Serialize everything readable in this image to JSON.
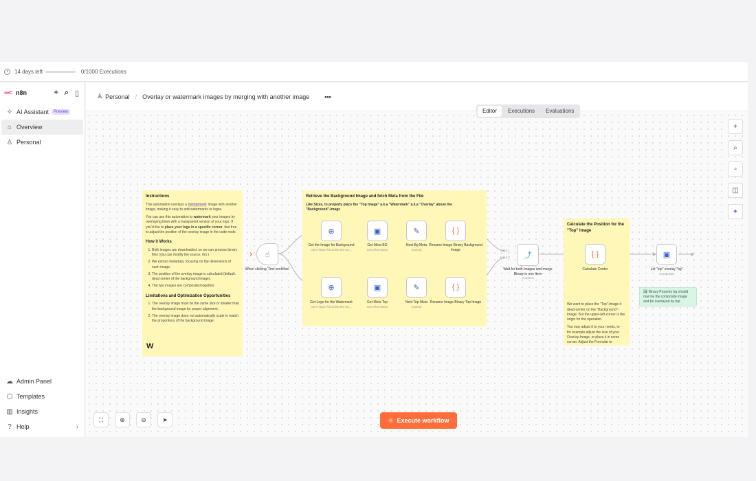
{
  "trial": {
    "days_left": "14 days left",
    "executions": "0/1000 Executions"
  },
  "sidebar": {
    "brand": "n8n",
    "items": [
      {
        "label": "AI Assistant",
        "badge": "Preview"
      },
      {
        "label": "Overview"
      },
      {
        "label": "Personal"
      }
    ],
    "bottom": [
      {
        "label": "Admin Panel"
      },
      {
        "label": "Templates"
      },
      {
        "label": "Insights"
      },
      {
        "label": "Help"
      }
    ]
  },
  "header": {
    "project": "Personal",
    "workflow_title": "Overlay or watermark images by merging with another image",
    "more": "•••"
  },
  "tabs": [
    "Editor",
    "Executions",
    "Evaluations"
  ],
  "stickies": {
    "instructions": {
      "title": "Instructions",
      "p1_a": "This automation overlays a ",
      "p1_code": "background",
      "p1_b": " image with another image, making it easy to add watermarks or logos.",
      "p2_a": "You can use this automation to ",
      "p2_bold": "watermark",
      "p2_b": " your images by overlaying them with a transparent version of your logo. If you'd like to ",
      "p2_bold2": "place your logo in a specific corner",
      "p2_c": ", feel free to adjust the position of the overlay image in the code node.",
      "how_title": "How it Works",
      "how": [
        "Both images are downloaded, so we can process binary files (you can modify the source, tho.)",
        "We extract metadata, focusing on the dimensions of each image.",
        "The position of the overlay image is calculated (default: dead center of the background image).",
        "The two images are composited together."
      ],
      "lim_title": "Limitations and Optimization Opportunities",
      "lim": [
        "The overlay image must be the same size or smaller than the background image for proper alignment.",
        "The overlay image does not automatically scale to match the proportions of the background image."
      ],
      "logo": "W"
    },
    "retrieve": {
      "title": "Retrieve the Background Image and fetch Meta from the File",
      "body": "Like Sizes, to properly place the \"Top Image\" a.k.a \"Watermark\" a.k.a \"Overlay\" above the \"Background\"-Image"
    },
    "calculate": {
      "title": "Calculate the Position for the \"Top\" Image",
      "p1": "We want to place the \"Top\"-Image it dead-center on the \"Background\"-Image. But the upper-left-corner is the origin for the operation.",
      "p2": "You may adjust it to your needs, to - for example adjust the size of your Overlay-Image, or place it in some corner. Adjust the Formular to"
    }
  },
  "nodes": [
    {
      "id": "trigger",
      "label": "When clicking ‘Test workflow’",
      "sub": "",
      "icon": "cursor-icon"
    },
    {
      "id": "get_bg",
      "label": "Get the Image for Background",
      "sub": "GET: https://cloudinit.the wo...",
      "icon": "globe-icon"
    },
    {
      "id": "meta_bg",
      "label": "Get Meta BG",
      "sub": "Get Information",
      "icon": "image-icon"
    },
    {
      "id": "next_bg",
      "label": "Next Bg Meta",
      "sub": "manual",
      "icon": "edit-icon"
    },
    {
      "id": "rename_bg",
      "label": "Rename Image Binary Background Image",
      "sub": "",
      "icon": "braces-icon"
    },
    {
      "id": "get_logo",
      "label": "Get Logo for the Watermark",
      "sub": "GET: https://cloudinit.the wo...",
      "icon": "globe-icon"
    },
    {
      "id": "meta_top",
      "label": "Get Meta Top",
      "sub": "Get Information",
      "icon": "image-icon"
    },
    {
      "id": "next_top",
      "label": "Next Top Meta",
      "sub": "manual",
      "icon": "edit-icon"
    },
    {
      "id": "rename_top",
      "label": "Rename Image Binary Top Image",
      "sub": "",
      "icon": "braces-icon"
    },
    {
      "id": "merge",
      "label": "Wait for both Images and merge Binary in one Item",
      "sub": "Combine",
      "icon": "merge-icon",
      "in1": "Input 1",
      "in2": "Input 2"
    },
    {
      "id": "calc",
      "label": "Calculate Center",
      "sub": "",
      "icon": "braces-icon"
    },
    {
      "id": "overlay",
      "label": "Let \"top\" overlay \"bg\"",
      "sub": "Composite",
      "icon": "image-icon"
    }
  ],
  "green_note": "🖼 Binary Property bg should now be the composite image and be overlayed by top",
  "execute_button": "Execute workflow",
  "icons": {
    "flask": "⚛"
  }
}
